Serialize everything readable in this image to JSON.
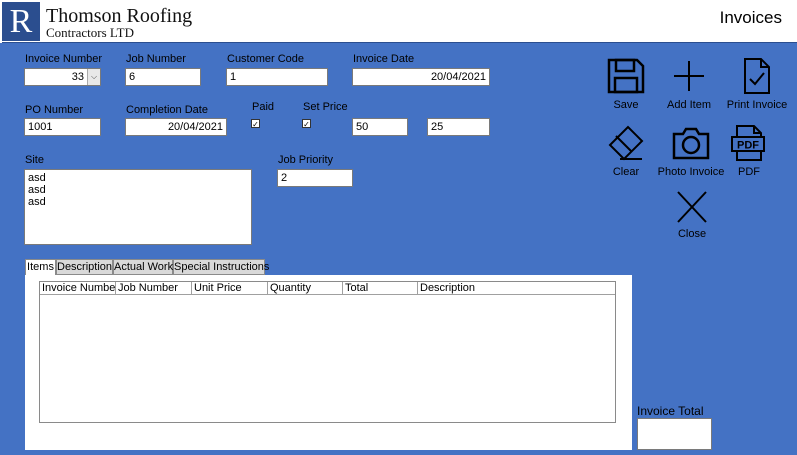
{
  "app": {
    "logo_letter": "R",
    "company_name": "Thomson Roofing",
    "company_sub": "Contractors LTD",
    "page_title": "Invoices"
  },
  "form": {
    "invoice_number": {
      "label": "Invoice Number",
      "value": "33"
    },
    "job_number": {
      "label": "Job Number",
      "value": "6"
    },
    "customer_code": {
      "label": "Customer Code",
      "value": "1"
    },
    "invoice_date": {
      "label": "Invoice Date",
      "value": "20/04/2021"
    },
    "po_number": {
      "label": "PO Number",
      "value": "1001"
    },
    "completion_date": {
      "label": "Completion Date",
      "value": "20/04/2021"
    },
    "paid": {
      "label": "Paid",
      "checked": true
    },
    "set_price": {
      "label": "Set Price",
      "checked": true
    },
    "price_field_1": "50",
    "price_field_2": "25",
    "site": {
      "label": "Site",
      "lines": [
        "asd",
        "asd",
        "asd"
      ]
    },
    "job_priority": {
      "label": "Job Priority",
      "value": "2"
    }
  },
  "tabs": [
    {
      "label": "Items",
      "active": true
    },
    {
      "label": "Description",
      "active": false
    },
    {
      "label": "Actual Work",
      "active": false
    },
    {
      "label": "Special Instructions",
      "active": false
    }
  ],
  "items_table": {
    "columns": [
      "Invoice Number",
      "Job Number",
      "Unit Price",
      "Quantity",
      "Total",
      "Description"
    ],
    "rows": []
  },
  "toolbar": {
    "save": {
      "label": "Save",
      "icon": "save-icon"
    },
    "add_item": {
      "label": "Add Item",
      "icon": "plus-icon"
    },
    "print_invoice": {
      "label": "Print Invoice",
      "icon": "document-check-icon"
    },
    "clear": {
      "label": "Clear",
      "icon": "eraser-icon"
    },
    "photo_invoice": {
      "label": "Photo Invoice",
      "icon": "camera-icon"
    },
    "pdf": {
      "label": "PDF",
      "icon": "pdf-icon"
    },
    "close": {
      "label": "Close",
      "icon": "close-icon"
    }
  },
  "invoice_total": {
    "label": "Invoice Total",
    "value": ""
  },
  "colors": {
    "background": "#4472c4",
    "brand": "#2b4e8f"
  }
}
